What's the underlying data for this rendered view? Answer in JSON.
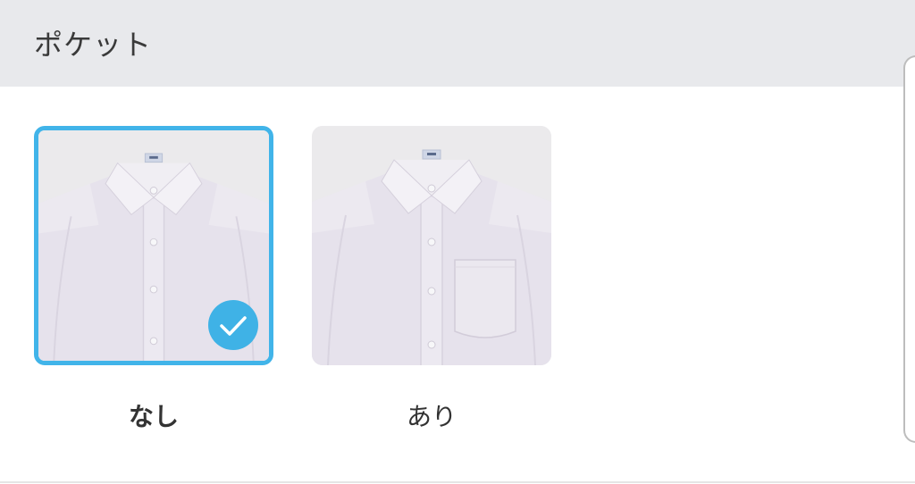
{
  "section": {
    "title": "ポケット"
  },
  "options": [
    {
      "label": "なし",
      "selected": true,
      "icon": "shirt-no-pocket-image"
    },
    {
      "label": "あり",
      "selected": false,
      "icon": "shirt-with-pocket-image"
    }
  ],
  "colors": {
    "accent": "#41b4e9",
    "header_bg": "#e8e9ec",
    "text": "#333333"
  },
  "icons": {
    "selected_badge": "checkmark-icon"
  }
}
